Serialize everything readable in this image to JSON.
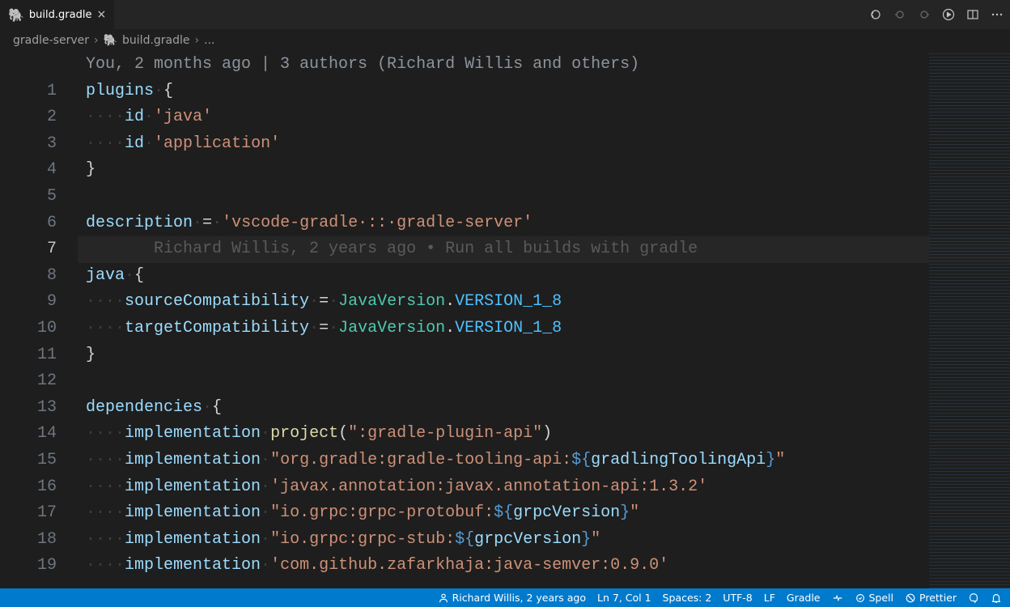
{
  "tab": {
    "title": "build.gradle"
  },
  "breadcrumbs": {
    "folder": "gradle-server",
    "file": "build.gradle",
    "trailing": "..."
  },
  "blame_header": "You, 2 months ago | 3 authors (Richard Willis and others)",
  "lines": {
    "1": {
      "tokens": [
        {
          "c": "id",
          "t": "plugins"
        },
        {
          "c": "ws",
          "t": "·"
        },
        {
          "c": "punc",
          "t": "{"
        }
      ]
    },
    "2": {
      "tokens": [
        {
          "c": "ws",
          "t": "····"
        },
        {
          "c": "id",
          "t": "id"
        },
        {
          "c": "ws",
          "t": "·"
        },
        {
          "c": "str",
          "t": "'java'"
        }
      ]
    },
    "3": {
      "tokens": [
        {
          "c": "ws",
          "t": "····"
        },
        {
          "c": "id",
          "t": "id"
        },
        {
          "c": "ws",
          "t": "·"
        },
        {
          "c": "str",
          "t": "'application'"
        }
      ]
    },
    "4": {
      "tokens": [
        {
          "c": "punc",
          "t": "}"
        }
      ]
    },
    "5": {
      "tokens": []
    },
    "6": {
      "tokens": [
        {
          "c": "id",
          "t": "description"
        },
        {
          "c": "ws",
          "t": "·"
        },
        {
          "c": "punc",
          "t": "="
        },
        {
          "c": "ws",
          "t": "·"
        },
        {
          "c": "str",
          "t": "'vscode-gradle·::·gradle-server'"
        }
      ]
    },
    "7": {
      "current": true,
      "ghost": "       Richard Willis, 2 years ago • Run all builds with gradle"
    },
    "8": {
      "tokens": [
        {
          "c": "id",
          "t": "java"
        },
        {
          "c": "ws",
          "t": "·"
        },
        {
          "c": "punc",
          "t": "{"
        }
      ]
    },
    "9": {
      "tokens": [
        {
          "c": "ws",
          "t": "····"
        },
        {
          "c": "id",
          "t": "sourceCompatibility"
        },
        {
          "c": "ws",
          "t": "·"
        },
        {
          "c": "punc",
          "t": "="
        },
        {
          "c": "ws",
          "t": "·"
        },
        {
          "c": "type",
          "t": "JavaVersion"
        },
        {
          "c": "punc",
          "t": "."
        },
        {
          "c": "const",
          "t": "VERSION_1_8"
        }
      ]
    },
    "10": {
      "tokens": [
        {
          "c": "ws",
          "t": "····"
        },
        {
          "c": "id",
          "t": "targetCompatibility"
        },
        {
          "c": "ws",
          "t": "·"
        },
        {
          "c": "punc",
          "t": "="
        },
        {
          "c": "ws",
          "t": "·"
        },
        {
          "c": "type",
          "t": "JavaVersion"
        },
        {
          "c": "punc",
          "t": "."
        },
        {
          "c": "const",
          "t": "VERSION_1_8"
        }
      ]
    },
    "11": {
      "tokens": [
        {
          "c": "punc",
          "t": "}"
        }
      ]
    },
    "12": {
      "tokens": []
    },
    "13": {
      "tokens": [
        {
          "c": "id",
          "t": "dependencies"
        },
        {
          "c": "ws",
          "t": "·"
        },
        {
          "c": "punc",
          "t": "{"
        }
      ]
    },
    "14": {
      "tokens": [
        {
          "c": "ws",
          "t": "····"
        },
        {
          "c": "id",
          "t": "implementation"
        },
        {
          "c": "ws",
          "t": "·"
        },
        {
          "c": "fn",
          "t": "project"
        },
        {
          "c": "punc",
          "t": "("
        },
        {
          "c": "str",
          "t": "\":gradle-plugin-api\""
        },
        {
          "c": "punc",
          "t": ")"
        }
      ]
    },
    "15": {
      "tokens": [
        {
          "c": "ws",
          "t": "····"
        },
        {
          "c": "id",
          "t": "implementation"
        },
        {
          "c": "ws",
          "t": "·"
        },
        {
          "c": "str",
          "t": "\"org.gradle:gradle-tooling-api:"
        },
        {
          "c": "interp-open",
          "t": "${"
        },
        {
          "c": "interp",
          "t": "gradlingToolingApi"
        },
        {
          "c": "interp-open",
          "t": "}"
        },
        {
          "c": "str",
          "t": "\""
        }
      ]
    },
    "16": {
      "tokens": [
        {
          "c": "ws",
          "t": "····"
        },
        {
          "c": "id",
          "t": "implementation"
        },
        {
          "c": "ws",
          "t": "·"
        },
        {
          "c": "str",
          "t": "'javax.annotation:javax.annotation-api:1.3.2'"
        }
      ]
    },
    "17": {
      "tokens": [
        {
          "c": "ws",
          "t": "····"
        },
        {
          "c": "id",
          "t": "implementation"
        },
        {
          "c": "ws",
          "t": "·"
        },
        {
          "c": "str",
          "t": "\"io.grpc:grpc-protobuf:"
        },
        {
          "c": "interp-open",
          "t": "${"
        },
        {
          "c": "interp",
          "t": "grpcVersion"
        },
        {
          "c": "interp-open",
          "t": "}"
        },
        {
          "c": "str",
          "t": "\""
        }
      ]
    },
    "18": {
      "tokens": [
        {
          "c": "ws",
          "t": "····"
        },
        {
          "c": "id",
          "t": "implementation"
        },
        {
          "c": "ws",
          "t": "·"
        },
        {
          "c": "str",
          "t": "\"io.grpc:grpc-stub:"
        },
        {
          "c": "interp-open",
          "t": "${"
        },
        {
          "c": "interp",
          "t": "grpcVersion"
        },
        {
          "c": "interp-open",
          "t": "}"
        },
        {
          "c": "str",
          "t": "\""
        }
      ]
    },
    "19": {
      "tokens": [
        {
          "c": "ws",
          "t": "····"
        },
        {
          "c": "id",
          "t": "implementation"
        },
        {
          "c": "ws",
          "t": "·"
        },
        {
          "c": "str",
          "t": "'com.github.zafarkhaja:java-semver:0.9.0'"
        }
      ]
    }
  },
  "status": {
    "blame": "Richard Willis, 2 years ago",
    "cursor": "Ln 7, Col 1",
    "indent": "Spaces: 2",
    "encoding": "UTF-8",
    "eol": "LF",
    "lang": "Gradle",
    "spell": "Spell",
    "prettier": "Prettier"
  }
}
